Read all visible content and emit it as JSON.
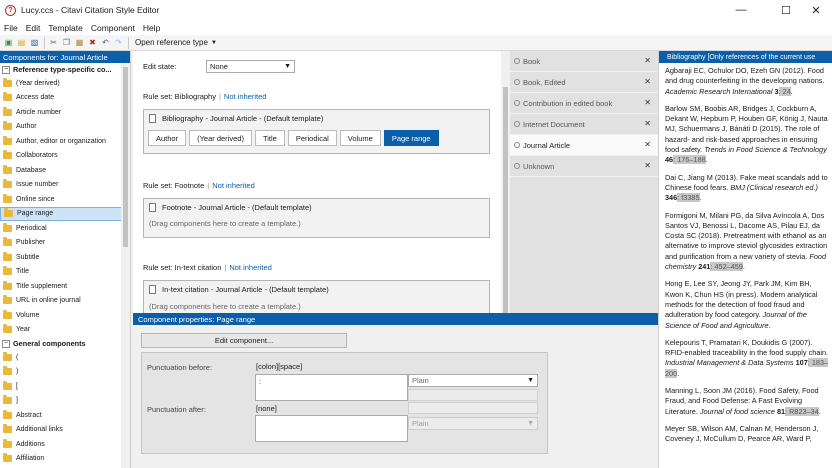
{
  "window": {
    "title": "Lucy.ccs - Citavi Citation Style Editor",
    "app_icon": "?"
  },
  "menu": [
    "File",
    "Edit",
    "Template",
    "Component",
    "Help"
  ],
  "toolbar": {
    "open_reference_type": "Open reference type"
  },
  "left_panel": {
    "header": "Components for: Journal Article",
    "group1": "Reference type-specific co...",
    "group1_items": [
      "(Year derived)",
      "Access date",
      "Article number",
      "Author",
      "Author, editor or organization",
      "Collaborators",
      "Database",
      "Issue number",
      "Online since",
      "Page range",
      "Periodical",
      "Publisher",
      "Subtitle",
      "Title",
      "Title supplement",
      "URL in online journal",
      "Volume",
      "Year"
    ],
    "selected_item": "Page range",
    "group2": "General components",
    "group2_items": [
      "(",
      ")",
      "[",
      "]",
      "Abstract",
      "Additional links",
      "Additions",
      "Affiliation"
    ]
  },
  "center": {
    "edit_state_label": "Edit state:",
    "edit_state_value": "None",
    "rules": [
      {
        "label": "Rule set: Bibliography",
        "status": "Not inherited",
        "template": "Bibliography - Journal Article - (Default template)",
        "chips": [
          "Author",
          "(Year derived)",
          "Title",
          "Periodical",
          "Volume",
          "Page range"
        ],
        "active_chip": "Page range"
      },
      {
        "label": "Rule set: Footnote",
        "status": "Not inherited",
        "template": "Footnote - Journal Article - (Default template)",
        "hint": "(Drag components here to create a template.)"
      },
      {
        "label": "Rule set: In-text citation",
        "status": "Not inherited",
        "template": "In-text citation - Journal Article - (Default template)",
        "hint": "(Drag components here to create a template.)"
      }
    ]
  },
  "types": [
    {
      "label": "Book",
      "selected": false
    },
    {
      "label": "Book, Edited",
      "selected": false
    },
    {
      "label": "Contribution in edited book",
      "selected": false
    },
    {
      "label": "Internet Document",
      "selected": false
    },
    {
      "label": "Journal Article",
      "selected": true
    },
    {
      "label": "Unknown",
      "selected": false
    }
  ],
  "props": {
    "header": "Component properties: Page range",
    "edit_button": "Edit component...",
    "punct_before_label": "Punctuation before:",
    "punct_before_value": "[colon][space]",
    "punct_before_input": ":",
    "punct_before_style": "Plain",
    "punct_after_label": "Punctuation after:",
    "punct_after_value": "[none]",
    "punct_after_style": "Plain"
  },
  "bibliography": {
    "header": "Bibliography [Only references of the current use",
    "entries": [
      {
        "text": "Agbaraji EC, Ochulor DO, Ezeh GN (2012). Food and drug counterfeiting in the developing nations. ",
        "journal": "Academic Research International",
        "vol": "3",
        "sep": ": ",
        "pages": "24",
        "end": "."
      },
      {
        "text": "Barlow SM, Boobis AR, Bridges J, Cockburn A, Dekant W, Hepburn P, Houben GF, König J, Nauta MJ, Schuermans J, Bánáti D (2015). The role of hazard- and risk-based approaches in ensuring food safety. ",
        "journal": "Trends in Food Science & Technology",
        "vol": "46",
        "sep": ": ",
        "pages": "176–188",
        "end": "."
      },
      {
        "text": "Dai C, Jiang M (2013). Fake meat scandals add to Chinese food fears. ",
        "journal": "BMJ (Clinical research ed.)",
        "vol": "346",
        "sep": ": ",
        "pages": "f3385",
        "end": "."
      },
      {
        "text": "Formigoni M, Milani PG, da Silva Avíncola A, Dos Santos VJ, Benossi L, Dacome AS, Pilau EJ, da Costa SC (2018). Pretreatment with ethanol as an alternative to improve steviol glycosides extraction and purification from a new variety of stevia. ",
        "journal": "Food chemistry",
        "vol": "241",
        "sep": ": ",
        "pages": "452–459",
        "end": "."
      },
      {
        "text": "Hong E, Lee SY, Jeong JY, Park JM, Kim BH, Kwon K, Chun HS (in press). Modern analytical methods for the detection of food fraud and adulteration by food category. ",
        "journal": "Journal of the Science of Food and Agriculture",
        "vol": "",
        "sep": "",
        "pages": "",
        "end": "."
      },
      {
        "text": "Kelepouris T, Pramatari K, Doukidis G (2007). RFID-enabled traceability in the food supply chain. ",
        "journal": "Industrial Management & Data Systems",
        "vol": "107",
        "sep": ": ",
        "pages": "183–200",
        "end": "."
      },
      {
        "text": "Manning L, Soon JM (2016). Food Safety, Food Fraud, and Food Defense: A Fast Evolving Literature. ",
        "journal": "Journal of food science",
        "vol": "81",
        "sep": ": ",
        "pages": "R823–34",
        "end": "."
      },
      {
        "text": "Meyer SB, Wilson AM, Calnan M, Henderson J, Coveney J, McCullum D, Pearce AR, Ward P,",
        "journal": "",
        "vol": "",
        "sep": "",
        "pages": "",
        "end": ""
      }
    ]
  }
}
